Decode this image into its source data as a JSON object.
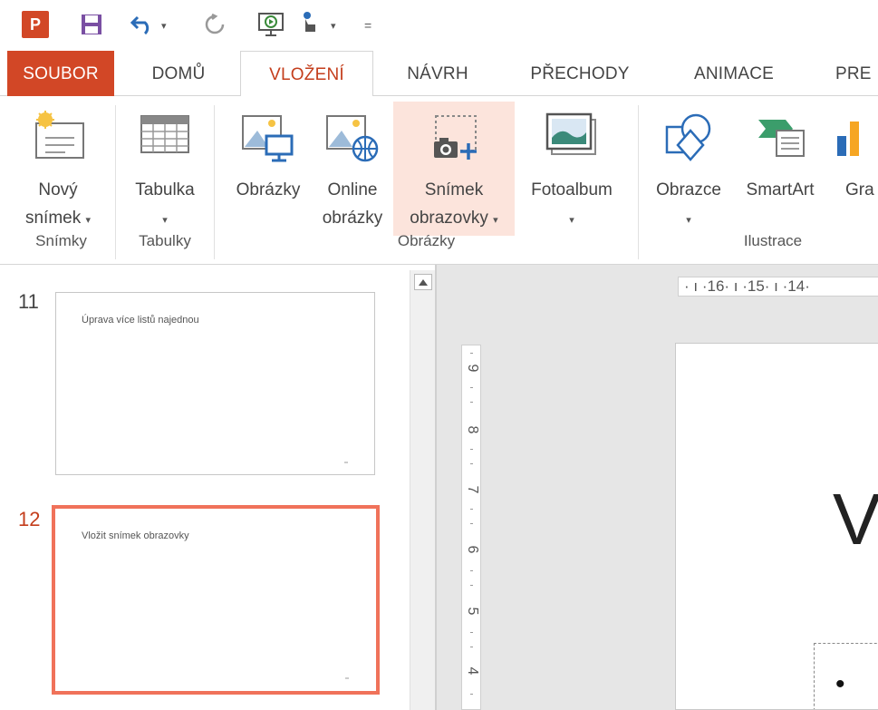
{
  "qat": {
    "icons": [
      "powerpoint-logo-icon",
      "save-icon",
      "undo-icon",
      "redo-icon",
      "present-from-start-icon",
      "touch-mode-icon",
      "customize-qat-icon"
    ],
    "logo_text": "P"
  },
  "tabs": [
    {
      "label": "SOUBOR"
    },
    {
      "label": "DOMŮ"
    },
    {
      "label": "VLOŽENÍ"
    },
    {
      "label": "NÁVRH"
    },
    {
      "label": "PŘECHODY"
    },
    {
      "label": "ANIMACE"
    },
    {
      "label": "PRE"
    }
  ],
  "ribbon": {
    "buttons": {
      "novy_snimek": {
        "line1": "Nový",
        "line2": "snímek"
      },
      "tabulka": {
        "line1": "Tabulka"
      },
      "obrazky": {
        "line1": "Obrázky"
      },
      "online_obrazky": {
        "line1": "Online",
        "line2": "obrázky"
      },
      "snimek_obrazovky": {
        "line1": "Snímek",
        "line2": "obrazovky"
      },
      "fotoalbum": {
        "line1": "Fotoalbum"
      },
      "obrazce": {
        "line1": "Obrazce"
      },
      "smartart": {
        "line1": "SmartArt"
      },
      "graf": {
        "line1": "Gra"
      }
    },
    "groups": {
      "snimky": "Snímky",
      "tabulky": "Tabulky",
      "obrazky": "Obrázky",
      "ilustrace": "Ilustrace"
    }
  },
  "slides": [
    {
      "number": "11",
      "title": "Úprava více listů najednou",
      "selected": false
    },
    {
      "number": "12",
      "title": "Vložit snímek obrazovky",
      "selected": true
    }
  ],
  "ruler": {
    "horizontal": "· ı ·16· ı ·15· ı ·14·",
    "vertical": [
      "9",
      "8",
      "7",
      "6",
      "5",
      "4"
    ]
  },
  "slide_canvas": {
    "title_fragment": "V",
    "bullet": "•"
  },
  "colors": {
    "file_tab": "#d24726",
    "active_tab_text": "#c43e1c",
    "selected_slide_border": "#f0725a",
    "highlight": "#fce4dc"
  }
}
